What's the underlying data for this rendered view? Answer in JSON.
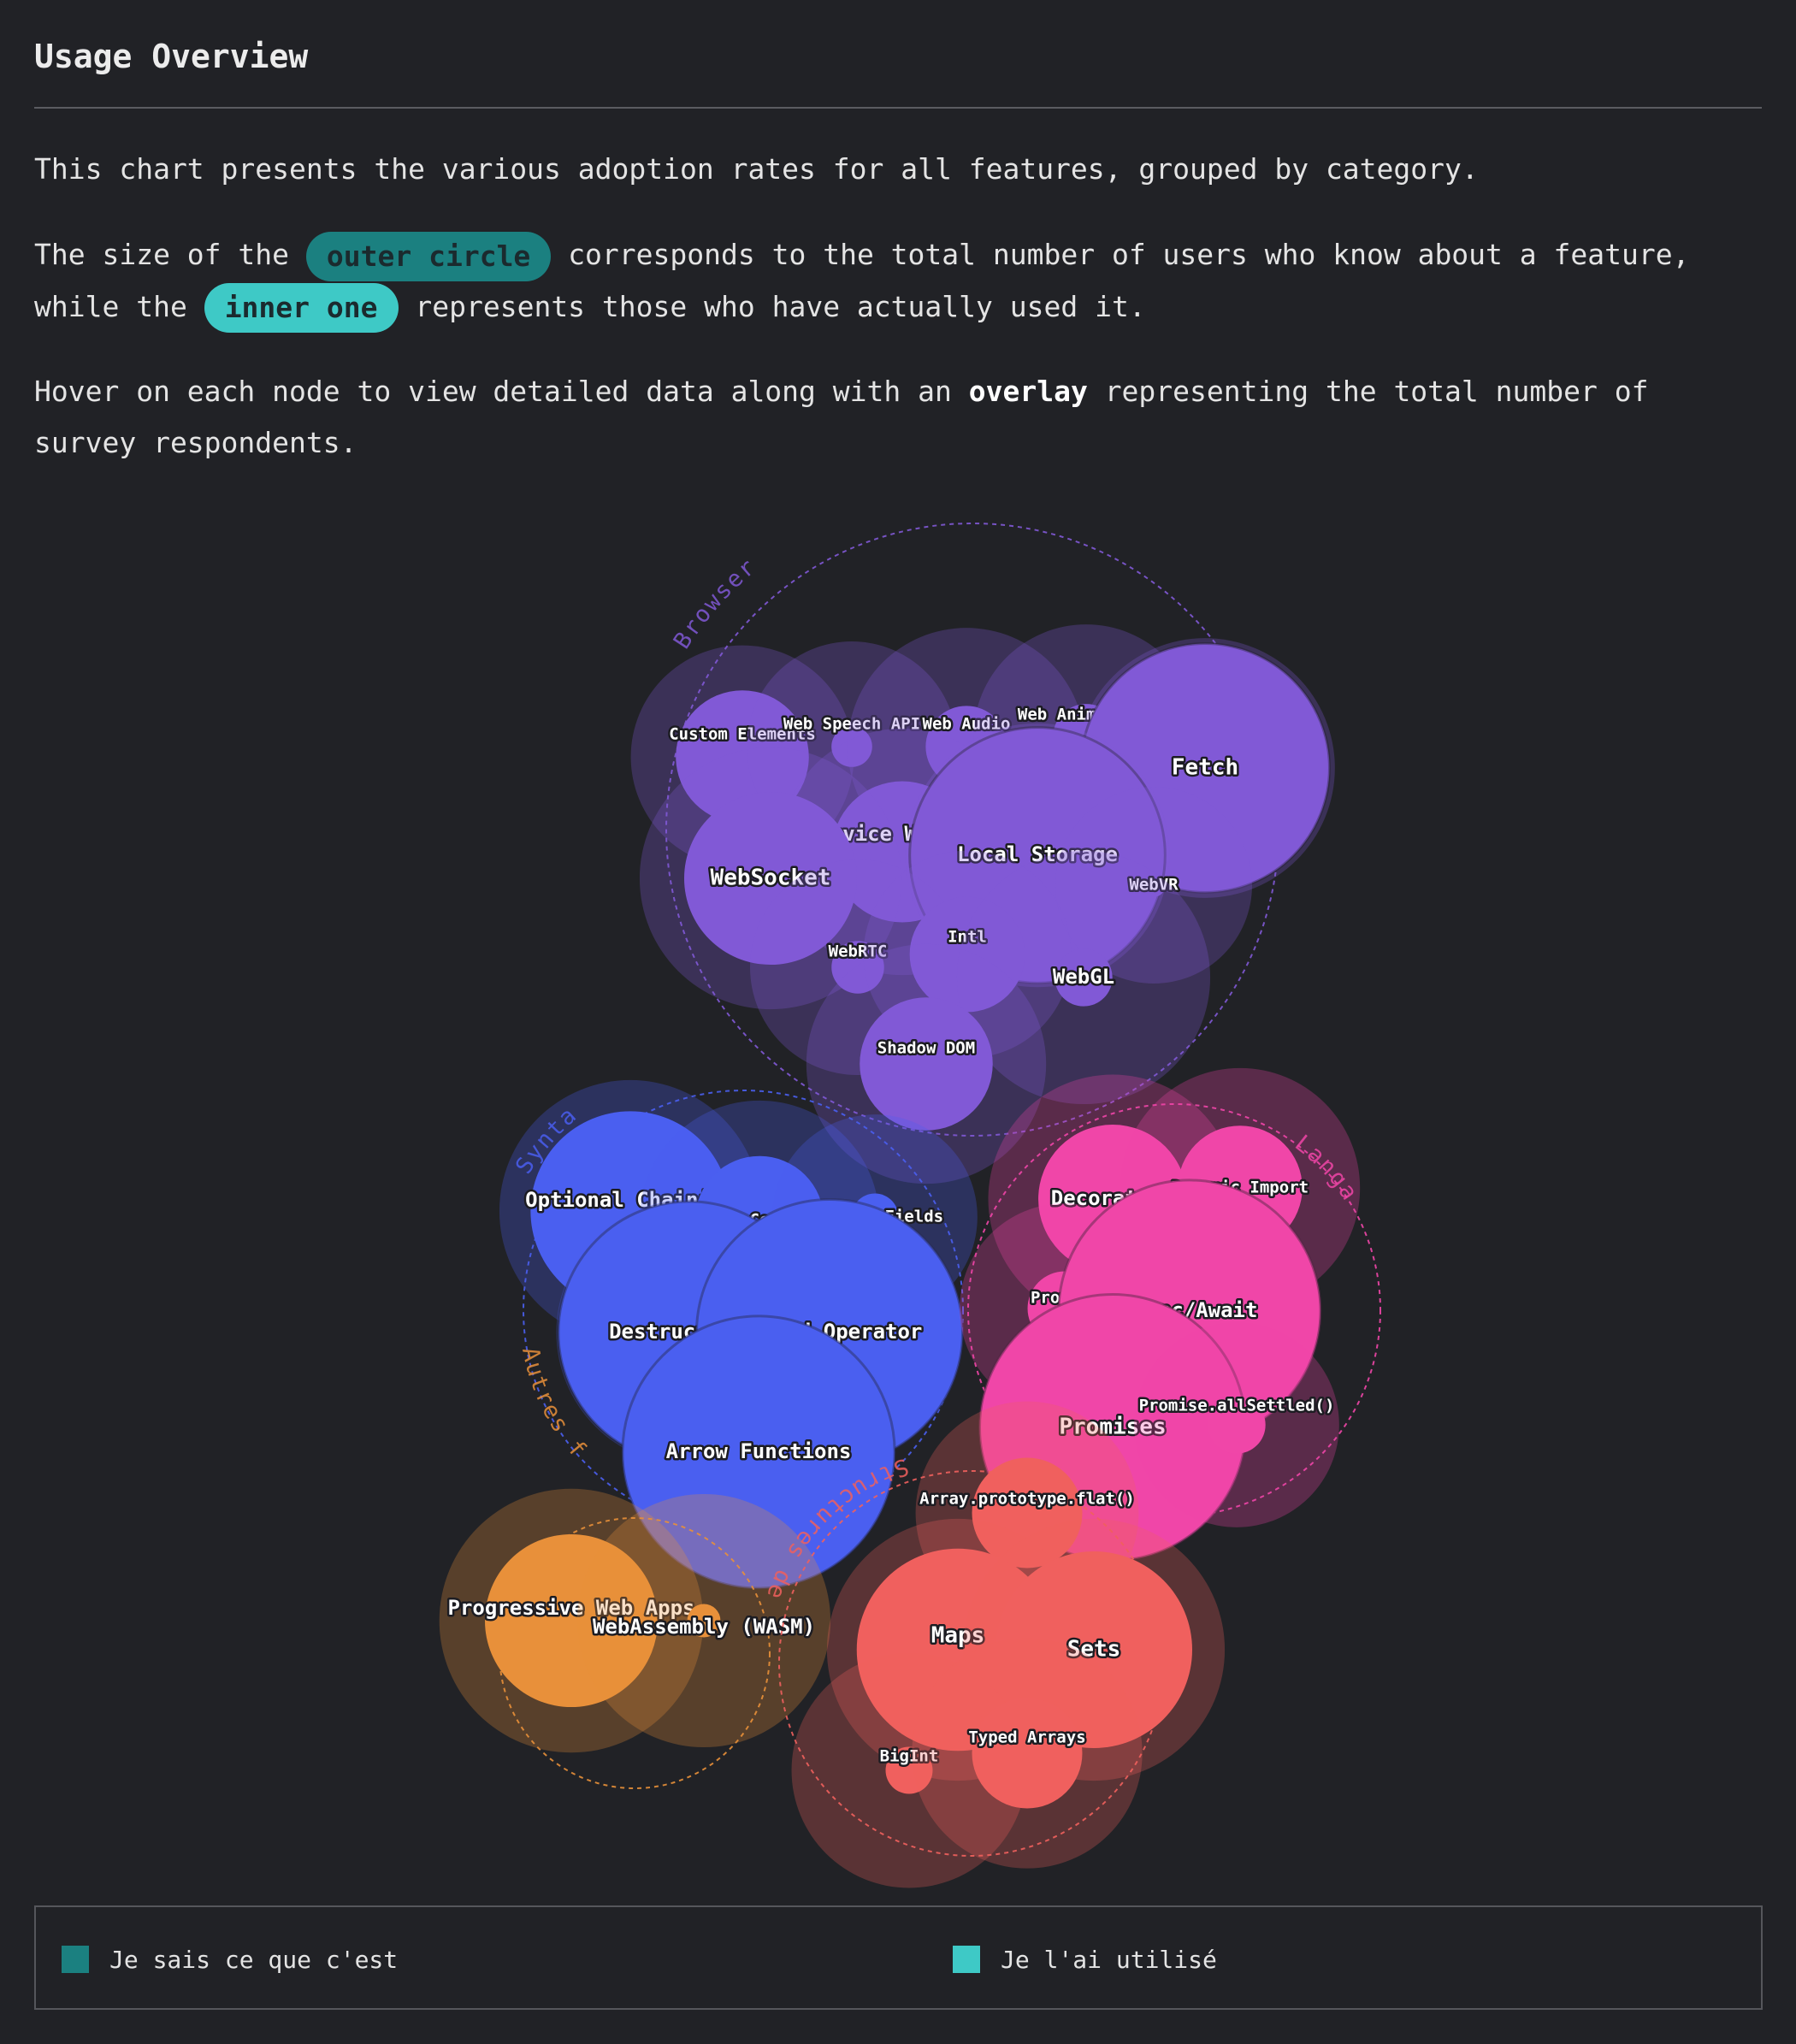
{
  "header": {
    "title": "Usage Overview"
  },
  "intro": {
    "p1": "This chart presents the various adoption rates for all features, grouped by category.",
    "p2_a": "The size of the",
    "p2_pill_outer": "outer circle",
    "p2_b": "corresponds to the total number of users who know about a feature,",
    "p2_c": "while the",
    "p2_pill_inner": "inner one",
    "p2_d": "represents those who have actually used it.",
    "p3_a": "Hover on each node to view detailed data along with an",
    "p3_strong": "overlay",
    "p3_b": "representing the total number of",
    "p3_c": "survey respondents."
  },
  "legend": {
    "items": [
      {
        "label": "Je sais ce que c'est",
        "color": "#1b8080"
      },
      {
        "label": "Je l'ai utilisé",
        "color": "#3ec9c6"
      }
    ]
  },
  "chart_data": {
    "type": "bubble-pack",
    "title": "",
    "value_meaning": {
      "outer": "Je sais ce que c'est",
      "inner": "Je l'ai utilisé"
    },
    "groups": [
      {
        "name": "Browser APIs",
        "color": "#8159d6",
        "features": [
          {
            "name": "Custom Elements",
            "outer": 45,
            "inner": 16
          },
          {
            "name": "Web Speech API",
            "outer": 40,
            "inner": 1.5
          },
          {
            "name": "Web Audio",
            "outer": 51,
            "inner": 6
          },
          {
            "name": "Web Animations",
            "outer": 46,
            "inner": 4
          },
          {
            "name": "Fetch",
            "outer": 61,
            "inner": 56
          },
          {
            "name": "Service Worker",
            "outer": 55,
            "inner": 18
          },
          {
            "name": "WebSocket",
            "outer": 62,
            "inner": 27
          },
          {
            "name": "Local Storage",
            "outer": 63,
            "inner": 59
          },
          {
            "name": "WebVR",
            "outer": 35,
            "inner": 0.5
          },
          {
            "name": "WebRTC",
            "outer": 42,
            "inner": 2.5
          },
          {
            "name": "Intl",
            "outer": 39,
            "inner": 12
          },
          {
            "name": "WebGL",
            "outer": 58,
            "inner": 3
          },
          {
            "name": "Shadow DOM",
            "outer": 52,
            "inner": 16
          }
        ]
      },
      {
        "name": "Syntaxe",
        "color": "#4a5ff0",
        "features": [
          {
            "name": "Optional Chaining",
            "outer": 62,
            "inner": 36
          },
          {
            "name": "Nullish Coalescing",
            "outer": 52,
            "inner": 15
          },
          {
            "name": "Private Fields",
            "outer": 38,
            "inner": 2
          },
          {
            "name": "Destructuring",
            "outer": 64,
            "inner": 62
          },
          {
            "name": "Spread Operator",
            "outer": 65,
            "inner": 64
          },
          {
            "name": "Arrow Functions",
            "outer": 68,
            "inner": 67
          }
        ]
      },
      {
        "name": "Langage",
        "color": "#f046a8",
        "features": [
          {
            "name": "Decorators",
            "outer": 56,
            "inner": 20
          },
          {
            "name": "Dynamic Import",
            "outer": 52,
            "inner": 14
          },
          {
            "name": "Proxies",
            "outer": 40,
            "inner": 5
          },
          {
            "name": "Async/Await",
            "outer": 63,
            "inner": 62
          },
          {
            "name": "Promises",
            "outer": 65,
            "inner": 64
          },
          {
            "name": "Promise.allSettled()",
            "outer": 38,
            "inner": 3
          }
        ]
      },
      {
        "name": "Autres fonctionnalités",
        "color": "#e8903a",
        "features": [
          {
            "name": "Progressive Web Apps",
            "outer": 63,
            "inner": 27
          },
          {
            "name": "WebAssembly (WASM)",
            "outer": 58,
            "inner": 1
          }
        ]
      },
      {
        "name": "Structures de données",
        "color": "#f0605e",
        "features": [
          {
            "name": "Array.prototype.flat()",
            "outer": 45,
            "inner": 11
          },
          {
            "name": "Maps",
            "outer": 62,
            "inner": 37
          },
          {
            "name": "Sets",
            "outer": 62,
            "inner": 35
          },
          {
            "name": "BigInt",
            "outer": 50,
            "inner": 2
          },
          {
            "name": "Typed Arrays",
            "outer": 48,
            "inner": 11
          }
        ]
      }
    ]
  }
}
